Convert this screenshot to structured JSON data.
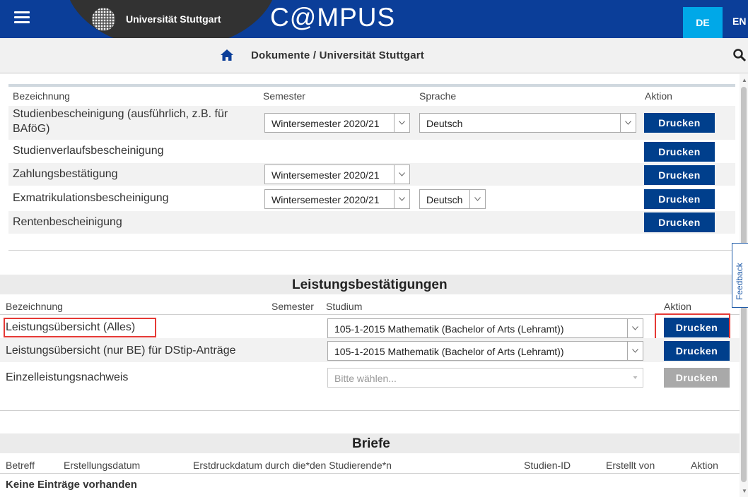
{
  "header": {
    "menu_icon": "hamburger-icon",
    "university": "Universität Stuttgart",
    "app_name": "C@MPUS",
    "lang_de": "DE",
    "lang_en": "EN",
    "colors": {
      "bar": "#0b3e99",
      "lang_active": "#00a8e8",
      "button": "#003f8c",
      "highlight": "#e53935"
    }
  },
  "subbar": {
    "breadcrumb": "Dokumente / Universität Stuttgart",
    "home_icon": "home-icon",
    "search_icon": "search-icon"
  },
  "documents": {
    "headers": {
      "name": "Bezeichnung",
      "semester": "Semester",
      "language": "Sprache",
      "action": "Aktion"
    },
    "rows": [
      {
        "name_line1": "Studienbescheinigung (ausführlich, z.B. für",
        "name_line2": "BAföG)",
        "semester": "Wintersemester 2020/21",
        "language": "Deutsch",
        "button": "Drucken"
      },
      {
        "name": "Studienverlaufsbescheinigung",
        "button": "Drucken"
      },
      {
        "name": "Zahlungsbestätigung",
        "semester": "Wintersemester 2020/21",
        "button": "Drucken"
      },
      {
        "name": "Exmatrikulationsbescheinigung",
        "semester": "Wintersemester 2020/21",
        "language": "Deutsch",
        "button": "Drucken"
      },
      {
        "name": "Rentenbescheinigung",
        "button": "Drucken"
      }
    ]
  },
  "achievements": {
    "title": "Leistungsbestätigungen",
    "headers": {
      "name": "Bezeichnung",
      "semester": "Semester",
      "study": "Studium",
      "action": "Aktion"
    },
    "rows": [
      {
        "name": "Leistungsübersicht (Alles)",
        "study": "105-1-2015 Mathematik (Bachelor of Arts (Lehramt))",
        "button": "Drucken"
      },
      {
        "name": "Leistungsübersicht (nur BE) für DStip-Anträge",
        "study": "105-1-2015 Mathematik (Bachelor of Arts (Lehramt))",
        "button": "Drucken"
      },
      {
        "name": "Einzelleistungsnachweis",
        "study_placeholder": "Bitte wählen...",
        "button": "Drucken"
      }
    ]
  },
  "letters": {
    "title": "Briefe",
    "headers": {
      "subject": "Betreff",
      "created": "Erstellungsdatum",
      "first_print": "Erstdruckdatum durch die*den Studierende*n",
      "study_id": "Studien-ID",
      "created_by": "Erstellt von",
      "action": "Aktion"
    },
    "empty": "Keine Einträge vorhanden"
  },
  "feedback": "Feedback"
}
